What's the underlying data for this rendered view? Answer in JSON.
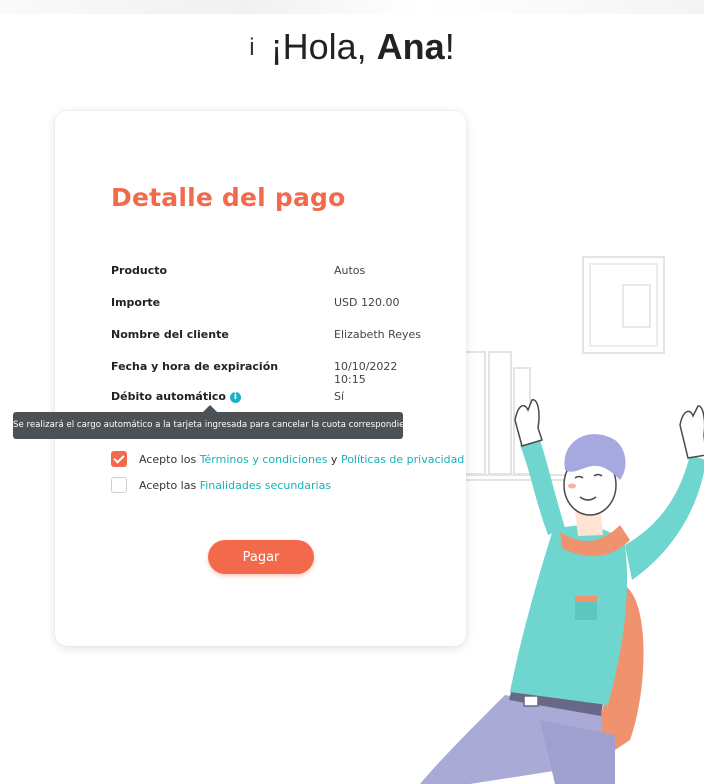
{
  "header": {
    "mark": "i",
    "greeting_prefix": "¡Hola, ",
    "user_name": "Ana",
    "greeting_suffix": "!"
  },
  "card": {
    "title": "Detalle del pago",
    "rows": [
      {
        "label": "Producto",
        "value": "Autos"
      },
      {
        "label": "Importe",
        "value": "USD 120.00"
      },
      {
        "label": "Nombre del cliente",
        "value": "Elizabeth Reyes"
      },
      {
        "label": "Fecha y hora de expiración",
        "value": "10/10/2022 10:15"
      },
      {
        "label": "Débito automático",
        "value": "Sí"
      }
    ],
    "info_icon_glyph": "i",
    "tooltip": "Se realizará el cargo automático a la tarjeta ingresada para cancelar la cuota correspondiente.",
    "terms": {
      "checked": true,
      "prefix": "Acepto los ",
      "link1": "Términos y condiciones",
      "middle": " y ",
      "link2": "Políticas de privacidad"
    },
    "secondary": {
      "checked": false,
      "prefix": "Acepto las ",
      "link": "Finalidades secundarias"
    },
    "pay_label": "Pagar"
  },
  "colors": {
    "accent": "#f26a4b",
    "link": "#16b2b8",
    "tooltip_bg": "#4b5155",
    "shirt": "#6fd6cf",
    "pants": "#a9aad6",
    "chair": "#f0926e"
  },
  "icons": {
    "info": "info-icon",
    "check": "checkmark-icon"
  }
}
